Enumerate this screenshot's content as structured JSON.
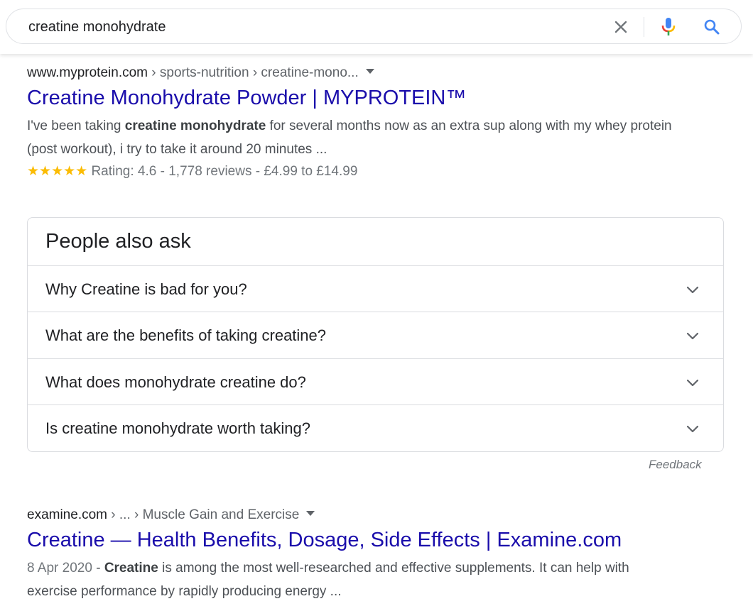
{
  "search": {
    "query": "creatine monohydrate"
  },
  "icons": {
    "clear": "close-icon",
    "mic": "microphone-icon",
    "search": "search-icon"
  },
  "colors": {
    "link": "#1a0dab",
    "star": "#fbbc04",
    "mic_blue": "#4285f4",
    "mic_red": "#ea4335",
    "mic_yellow": "#fbbc04",
    "mic_green": "#34a853"
  },
  "results": [
    {
      "domain": "www.myprotein.com",
      "path": " › sports-nutrition › creatine-mono...",
      "title": "Creatine Monohydrate Powder | MYPROTEIN™",
      "snippet_pre": "I've been taking ",
      "snippet_bold": "creatine monohydrate",
      "snippet_post": " for several months now as an extra sup along with my whey protein (post workout), i try to take it around 20 minutes ...",
      "stars": "★★★★★",
      "rating_value": 4.6,
      "rating_text": "Rating: 4.6 - 1,778 reviews - £4.99 to £14.99"
    },
    {
      "domain": "examine.com",
      "path": " › ... › Muscle Gain and Exercise",
      "title": "Creatine — Health Benefits, Dosage, Side Effects | Examine.com",
      "date": "8 Apr 2020",
      "snippet_sep": " - ",
      "snippet_bold": "Creatine",
      "snippet_post": " is among the most well-researched and effective supplements. It can help with exercise performance by rapidly producing energy ..."
    }
  ],
  "people_also_ask": {
    "title": "People also ask",
    "questions": [
      "Why Creatine is bad for you?",
      "What are the benefits of taking creatine?",
      "What does monohydrate creatine do?",
      "Is creatine monohydrate worth taking?"
    ],
    "feedback": "Feedback"
  }
}
